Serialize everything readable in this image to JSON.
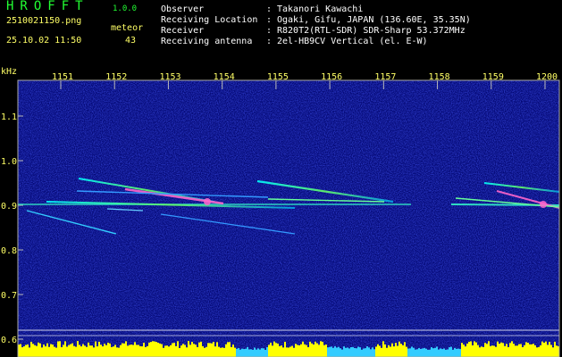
{
  "app": {
    "title": "HROFFT",
    "version": "1.0.0"
  },
  "file": {
    "name": "2510021150.png",
    "datetime": "25.10.02 11:50"
  },
  "meteor": {
    "label": "meteor",
    "count": "43"
  },
  "info": [
    {
      "label": "Observer",
      "sep": ":",
      "value": "Takanori Kawachi"
    },
    {
      "label": "Receiving Location",
      "sep": ":",
      "value": "Ogaki, Gifu, JAPAN (136.60E, 35.35N)"
    },
    {
      "label": "Receiver",
      "sep": ":",
      "value": "R820T2(RTL-SDR) SDR-Sharp 53.372MHz"
    },
    {
      "label": "Receiving antenna",
      "sep": ":",
      "value": "2el-HB9CV Vertical (el. E-W)"
    }
  ],
  "axis": {
    "y_unit": "kHz",
    "y_ticks": [
      "1.1",
      "1.0",
      "0.9",
      "0.8",
      "0.7",
      "0.6"
    ],
    "x_ticks": [
      "1151",
      "1152",
      "1153",
      "1154",
      "1155",
      "1156",
      "1157",
      "1158",
      "1159",
      "1200"
    ]
  },
  "colors": {
    "background": "#000000",
    "noise": "#0a0c8c",
    "text": "#ffff66",
    "signal": "#00ffff",
    "power": "#ffff00"
  }
}
